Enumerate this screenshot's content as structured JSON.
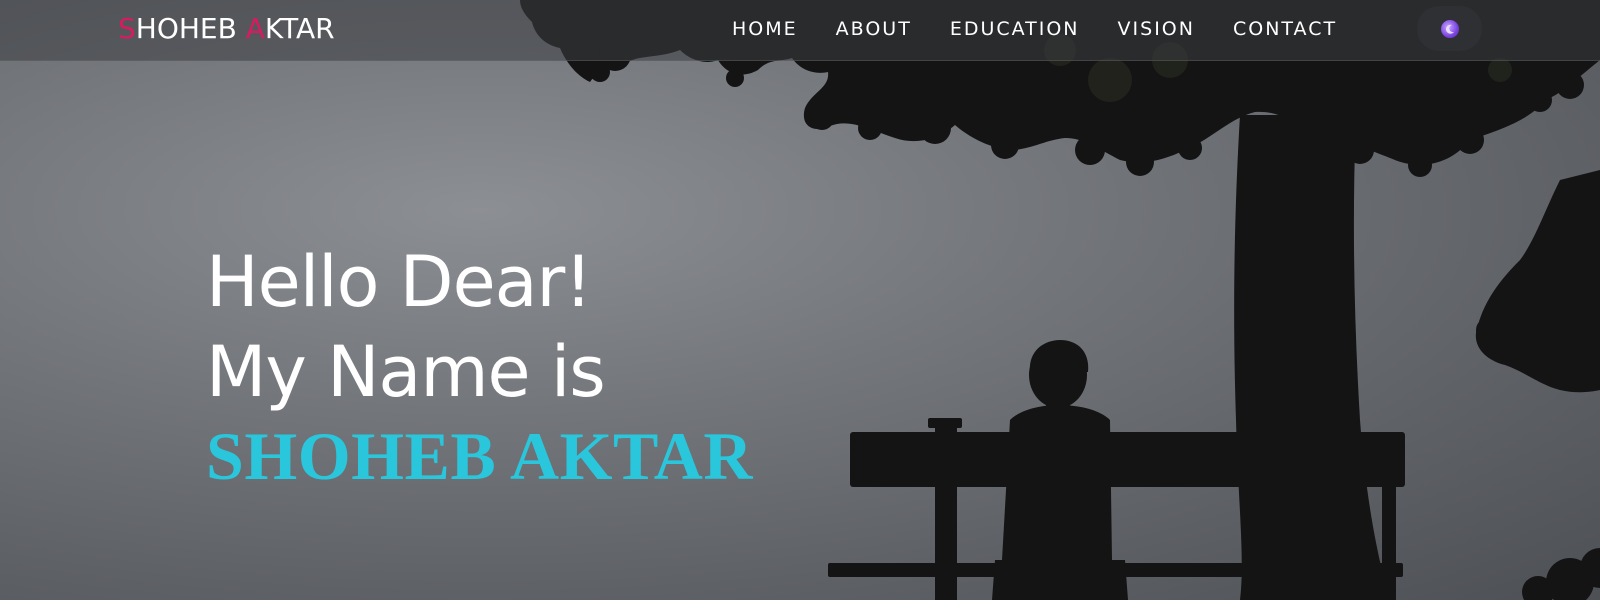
{
  "brand": {
    "first_initial": "S",
    "first_rest": "HOHEB ",
    "last_initial": "A",
    "last_rest": "KTAR"
  },
  "nav": {
    "items": [
      {
        "label": "HOME"
      },
      {
        "label": "ABOUT"
      },
      {
        "label": "EDUCATION"
      },
      {
        "label": "VISION"
      },
      {
        "label": "CONTACT"
      }
    ],
    "theme_toggle_icon": "moon-icon"
  },
  "hero": {
    "line1": "Hello Dear!",
    "line2": "My Name is",
    "name": "SHOHEB AKTAR"
  },
  "colors": {
    "brand_accent": "#d81b60",
    "name_accent": "#29c6dc",
    "toggle_bg": "#2f3033",
    "toggle_dot": "#7a43e0"
  }
}
